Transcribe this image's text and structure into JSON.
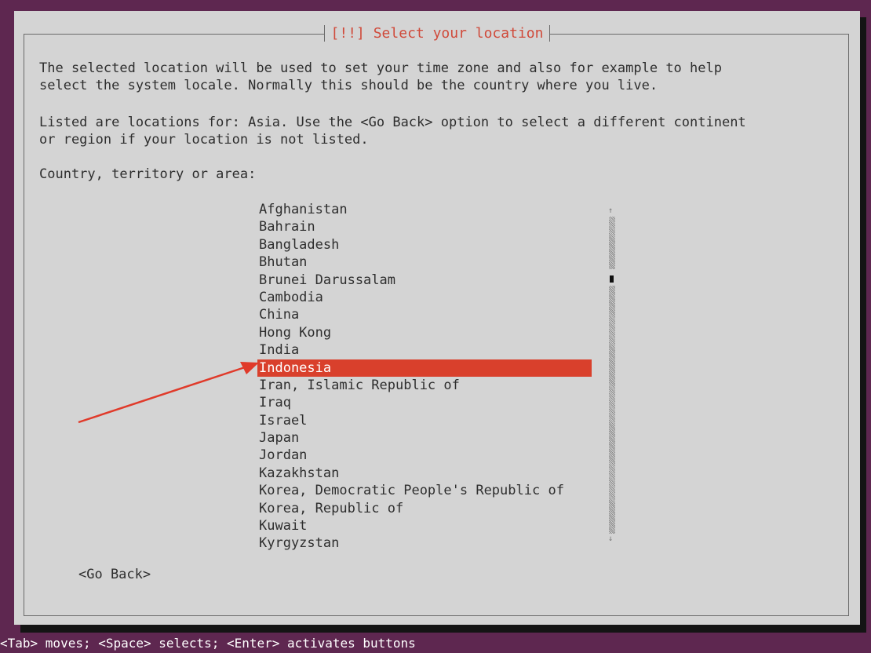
{
  "dialog": {
    "title": "[!!] Select your location",
    "description_line1": "The selected location will be used to set your time zone and also for example to help",
    "description_line2": "select the system locale. Normally this should be the country where you live.",
    "info_line1": "Listed are locations for: Asia. Use the <Go Back> option to select a different continent",
    "info_line2": "or region if your location is not listed.",
    "prompt": "Country, territory or area:",
    "go_back_label": "<Go Back>"
  },
  "countries": [
    "Afghanistan",
    "Bahrain",
    "Bangladesh",
    "Bhutan",
    "Brunei Darussalam",
    "Cambodia",
    "China",
    "Hong Kong",
    "India",
    "Indonesia",
    "Iran, Islamic Republic of",
    "Iraq",
    "Israel",
    "Japan",
    "Jordan",
    "Kazakhstan",
    "Korea, Democratic People's Republic of",
    "Korea, Republic of",
    "Kuwait",
    "Kyrgyzstan"
  ],
  "selected_index": 9,
  "status_bar": "<Tab> moves; <Space> selects; <Enter> activates buttons",
  "colors": {
    "background": "#5e2750",
    "dialog": "#d4d4d4",
    "highlight": "#d9402c",
    "title": "#d04a3a",
    "annotation_arrow": "#e03a2a"
  },
  "icons": {
    "scroll_up": "up-arrow-icon",
    "scroll_down": "down-arrow-icon",
    "annotation": "red-arrow-icon"
  }
}
